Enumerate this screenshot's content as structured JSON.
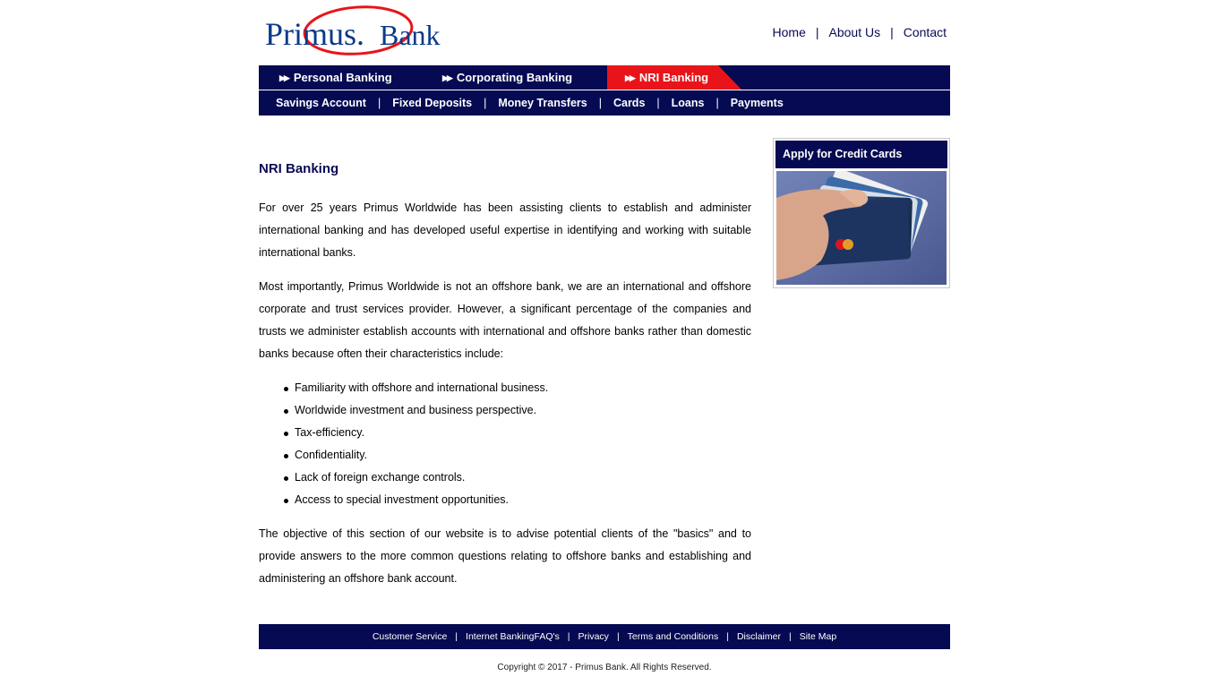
{
  "brand": {
    "name_part1": "Primus.",
    "name_part2": "Bank",
    "colors": {
      "navy": "#050a52",
      "red": "#e8141a"
    }
  },
  "top_links": [
    "Home",
    "About Us",
    "Contact"
  ],
  "tabs": [
    {
      "label": "Personal Banking",
      "active": false
    },
    {
      "label": "Corporating Banking",
      "active": false
    },
    {
      "label": "NRI Banking",
      "active": true
    }
  ],
  "subnav": [
    "Savings Account",
    "Fixed Deposits",
    "Money Transfers",
    "Cards",
    "Loans",
    "Payments"
  ],
  "content": {
    "heading": "NRI Banking",
    "paragraph1": "For over 25 years Primus Worldwide has been assisting clients to establish and administer international banking and has developed useful expertise in identifying and working with suitable international banks.",
    "paragraph2": "Most importantly, Primus Worldwide is not an offshore bank, we are an international and offshore corporate and trust services provider. However, a significant percentage of the companies and trusts we administer establish accounts with international and offshore banks rather than domestic banks because often their characteristics include:",
    "bullets": [
      "Familiarity with offshore and international business.",
      "Worldwide investment and business perspective.",
      "Tax-efficiency.",
      "Confidentiality.",
      "Lack of foreign exchange controls.",
      "Access to special investment opportunities."
    ],
    "paragraph3": "The objective of this section of our website is to advise potential clients of the \"basics\" and to provide answers to the more common questions relating to offshore banks and establishing and administering an offshore bank account."
  },
  "sidebar": {
    "title": "Apply for Credit Cards",
    "image": "hand-holding-credit-cards"
  },
  "footer": {
    "links": [
      "Customer Service",
      "Internet BankingFAQ's",
      "Privacy",
      "Terms and Conditions",
      "Disclaimer",
      "Site Map"
    ],
    "copyright": "Copyright © 2017 - Primus Bank. All Rights Reserved."
  }
}
